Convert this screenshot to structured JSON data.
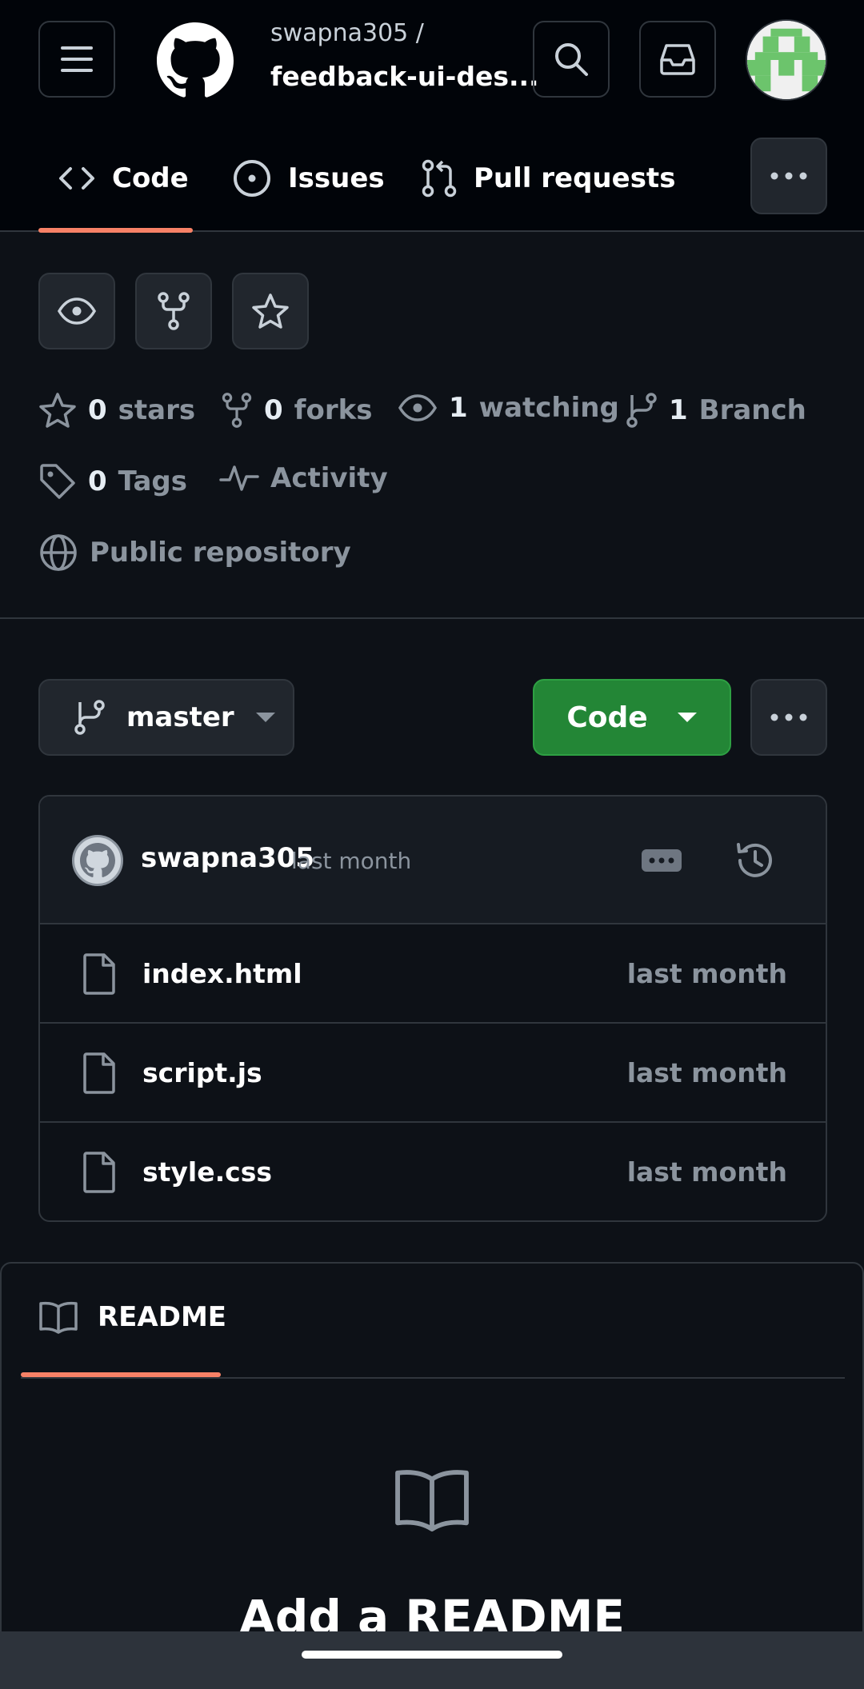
{
  "header": {
    "owner": "swapna305 /",
    "repo_name": "feedback-ui-des...",
    "menu_icon": "hamburger-menu-icon",
    "logo_icon": "github-logo-icon",
    "search_icon": "search-icon",
    "inbox_icon": "inbox-icon",
    "avatar_icon": "user-avatar-icon"
  },
  "tabs": [
    {
      "label": "Code",
      "icon": "code-icon",
      "active": true
    },
    {
      "label": "Issues",
      "icon": "issue-opened-icon",
      "active": false
    },
    {
      "label": "Pull requests",
      "icon": "git-pull-request-icon",
      "active": false
    }
  ],
  "accent": {
    "tab_underline": "#f78166",
    "primary_button": "#238636",
    "background": "#0d1117",
    "header_background": "#010409"
  },
  "stats": {
    "stars": {
      "num": "0",
      "label": "stars"
    },
    "forks": {
      "num": "0",
      "label": "forks"
    },
    "watching": {
      "num": "1",
      "label": "watching"
    },
    "branch": {
      "num": "1",
      "label": "Branch"
    },
    "tags": {
      "num": "0",
      "label": "Tags"
    },
    "activity": {
      "label": "Activity"
    },
    "visibility": {
      "label": "Public repository"
    }
  },
  "branch_selector": {
    "label": "master"
  },
  "code_button": {
    "label": "Code"
  },
  "latest_commit": {
    "user": "swapna305",
    "time": "last month"
  },
  "files": [
    {
      "name": "index.html",
      "time": "last month"
    },
    {
      "name": "script.js",
      "time": "last month"
    },
    {
      "name": "style.css",
      "time": "last month"
    }
  ],
  "readme": {
    "tab_label": "README",
    "heading": "Add a README"
  }
}
